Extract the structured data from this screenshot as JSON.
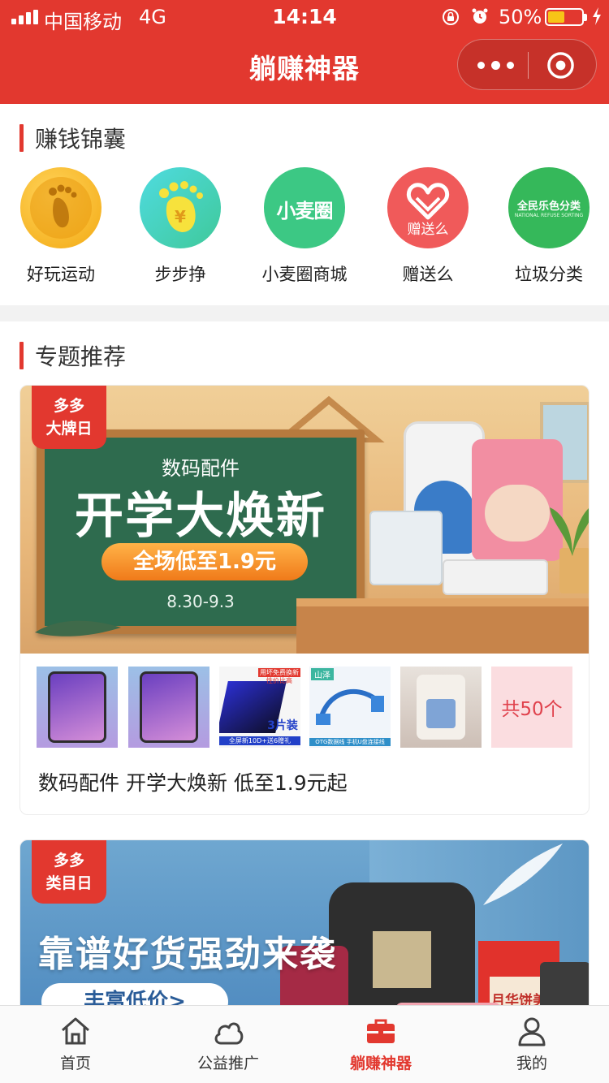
{
  "status_bar": {
    "carrier": "中国移动",
    "network": "4G",
    "time": "14:14",
    "battery_percent": "50%",
    "battery_level": 0.5,
    "icons": [
      "signal-icon",
      "rotation-lock-icon",
      "alarm-icon",
      "battery-icon",
      "charging-icon"
    ]
  },
  "nav": {
    "title": "躺赚神器",
    "menu_icon": "more-dots-icon",
    "close_icon": "target-icon"
  },
  "colors": {
    "brand_red": "#e2382f",
    "badge_pink": "#fbdde0",
    "badge_text": "#e0424d"
  },
  "section_money": {
    "title": "赚钱锦囊",
    "items": [
      {
        "label": "好玩运动",
        "icon": "footprint-icon",
        "color": "#f5b01e"
      },
      {
        "label": "步步挣",
        "icon": "yen-footprint-icon",
        "color": "#3fd0d8"
      },
      {
        "label": "小麦圈商城",
        "icon": "xiaomaiquan-logo",
        "logo_text": "小麦圈",
        "color": "#3cc884"
      },
      {
        "label": "赠送么",
        "icon": "heart-gift-icon",
        "logo_text": "赠送么",
        "color": "#f05a5a"
      },
      {
        "label": "垃圾分类",
        "icon": "garbage-sort-logo",
        "logo_text": "全民乐色分类",
        "logo_subtext": "NATIONAL REFUSE SORTING",
        "color": "#35b85a"
      }
    ]
  },
  "section_topics": {
    "title": "专题推荐",
    "cards": [
      {
        "badge_line1": "多多",
        "badge_line2": "大牌日",
        "banner_subtitle": "数码配件",
        "banner_headline": "开学大焕新",
        "banner_pill": "全场低至1.9元",
        "banner_dates": "8.30-9.3",
        "thumbnails": [
          {
            "icon": "phone-case-thumb"
          },
          {
            "icon": "phone-case-thumb"
          },
          {
            "icon": "screen-protector-thumb",
            "text_top": "用坏免费换新",
            "text_mid": "性价比高",
            "text_big": "3片装",
            "text_bottom": "全屏新10D+送6赠礼"
          },
          {
            "icon": "otg-cable-thumb",
            "tag": "山泽",
            "caption": "OTG数据线 手机U盘连接线"
          },
          {
            "icon": "crossbody-bag-thumb"
          }
        ],
        "count_label": "共50个",
        "caption": "数码配件 开学大焕新 低至1.9元起"
      },
      {
        "badge_line1": "多多",
        "badge_line2": "类目日",
        "banner_headline": "靠谱好货强劲来袭",
        "banner_pill": "丰富低价>",
        "banner_box_text": "月华饼美"
      }
    ]
  },
  "tabbar": {
    "tabs": [
      {
        "label": "首页",
        "icon": "home-icon",
        "active": false
      },
      {
        "label": "公益推广",
        "icon": "cloud-icon",
        "active": false
      },
      {
        "label": "躺赚神器",
        "icon": "briefcase-icon",
        "active": true
      },
      {
        "label": "我的",
        "icon": "user-icon",
        "active": false
      }
    ]
  }
}
